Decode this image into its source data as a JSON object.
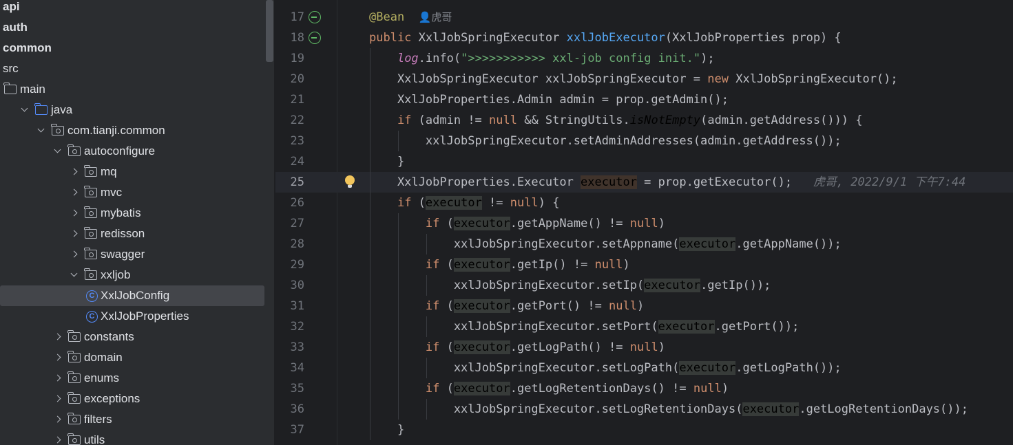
{
  "tree": [
    {
      "label": "api",
      "bold": true,
      "indent": 0,
      "arrow": "none",
      "icon": "none"
    },
    {
      "label": "auth",
      "bold": true,
      "indent": 0,
      "arrow": "none",
      "icon": "none"
    },
    {
      "label": "common",
      "bold": true,
      "indent": 0,
      "arrow": "none",
      "icon": "none"
    },
    {
      "label": "src",
      "bold": false,
      "indent": 0,
      "arrow": "none",
      "icon": "none"
    },
    {
      "label": "main",
      "bold": false,
      "indent": 0,
      "arrow": "none",
      "icon": "folder"
    },
    {
      "label": "java",
      "bold": false,
      "indent": 1,
      "arrow": "open",
      "icon": "folder-blue"
    },
    {
      "label": "com.tianji.common",
      "bold": false,
      "indent": 2,
      "arrow": "open",
      "icon": "package"
    },
    {
      "label": "autoconfigure",
      "bold": false,
      "indent": 3,
      "arrow": "open",
      "icon": "package"
    },
    {
      "label": "mq",
      "bold": false,
      "indent": 4,
      "arrow": "closed",
      "icon": "package"
    },
    {
      "label": "mvc",
      "bold": false,
      "indent": 4,
      "arrow": "closed",
      "icon": "package"
    },
    {
      "label": "mybatis",
      "bold": false,
      "indent": 4,
      "arrow": "closed",
      "icon": "package"
    },
    {
      "label": "redisson",
      "bold": false,
      "indent": 4,
      "arrow": "closed",
      "icon": "package"
    },
    {
      "label": "swagger",
      "bold": false,
      "indent": 4,
      "arrow": "closed",
      "icon": "package"
    },
    {
      "label": "xxljob",
      "bold": false,
      "indent": 4,
      "arrow": "open",
      "icon": "package"
    },
    {
      "label": "XxlJobConfig",
      "bold": false,
      "indent": 5,
      "arrow": "none",
      "icon": "class",
      "selected": true
    },
    {
      "label": "XxlJobProperties",
      "bold": false,
      "indent": 5,
      "arrow": "none",
      "icon": "class"
    },
    {
      "label": "constants",
      "bold": false,
      "indent": 3,
      "arrow": "closed",
      "icon": "package"
    },
    {
      "label": "domain",
      "bold": false,
      "indent": 3,
      "arrow": "closed",
      "icon": "package"
    },
    {
      "label": "enums",
      "bold": false,
      "indent": 3,
      "arrow": "closed",
      "icon": "package"
    },
    {
      "label": "exceptions",
      "bold": false,
      "indent": 3,
      "arrow": "closed",
      "icon": "package"
    },
    {
      "label": "filters",
      "bold": false,
      "indent": 3,
      "arrow": "closed",
      "icon": "package"
    },
    {
      "label": "utils",
      "bold": false,
      "indent": 3,
      "arrow": "closed",
      "icon": "package"
    }
  ],
  "editor": {
    "current_line": 25,
    "lines": [
      {
        "num": "17",
        "gutter": "bean-icon",
        "guides": 0,
        "segs": [
          [
            "ann",
            "@Bean"
          ],
          [
            "txt",
            "  "
          ],
          [
            "author",
            "👤虎哥"
          ]
        ]
      },
      {
        "num": "18",
        "gutter": "bean-icon",
        "guides": 0,
        "segs": [
          [
            "kw",
            "public "
          ],
          [
            "txt",
            "XxlJobSpringExecutor "
          ],
          [
            "fn",
            "xxlJobExecutor"
          ],
          [
            "txt",
            "(XxlJobProperties prop) {"
          ]
        ]
      },
      {
        "num": "19",
        "guides": 1,
        "segs": [
          [
            "txt",
            "    "
          ],
          [
            "fld",
            "log"
          ],
          [
            "txt",
            ".info("
          ],
          [
            "str",
            "\">>>>>>>>>>> xxl-job config init.\""
          ],
          [
            "txt",
            ");"
          ]
        ]
      },
      {
        "num": "20",
        "guides": 1,
        "segs": [
          [
            "txt",
            "    XxlJobSpringExecutor xxlJobSpringExecutor = "
          ],
          [
            "kw",
            "new "
          ],
          [
            "txt",
            "XxlJobSpringExecutor();"
          ]
        ]
      },
      {
        "num": "21",
        "guides": 1,
        "segs": [
          [
            "txt",
            "    XxlJobProperties.Admin admin = prop.getAdmin();"
          ]
        ]
      },
      {
        "num": "22",
        "guides": 1,
        "segs": [
          [
            "txt",
            "    "
          ],
          [
            "kw",
            "if "
          ],
          [
            "txt",
            "(admin != "
          ],
          [
            "kw",
            "null "
          ],
          [
            "txt",
            "&& StringUtils."
          ],
          [
            "ital",
            "isNotEmpty"
          ],
          [
            "txt",
            "(admin.getAddress())) {"
          ]
        ]
      },
      {
        "num": "23",
        "guides": 2,
        "segs": [
          [
            "txt",
            "        xxlJobSpringExecutor.setAdminAddresses(admin.getAddress());"
          ]
        ]
      },
      {
        "num": "24",
        "guides": 1,
        "segs": [
          [
            "txt",
            "    }"
          ]
        ]
      },
      {
        "num": "25",
        "gutter": "bulb",
        "guides": 1,
        "segs": [
          [
            "txt",
            "    XxlJobProperties.Executor "
          ],
          [
            "hlw",
            "executor"
          ],
          [
            "txt",
            " = prop.getExecutor();   "
          ],
          [
            "blame",
            "虎哥, 2022/9/1 下午7:44"
          ]
        ]
      },
      {
        "num": "26",
        "guides": 1,
        "segs": [
          [
            "txt",
            "    "
          ],
          [
            "kw",
            "if "
          ],
          [
            "txt",
            "("
          ],
          [
            "hl",
            "executor"
          ],
          [
            "txt",
            " != "
          ],
          [
            "kw",
            "null"
          ],
          [
            "txt",
            ") {"
          ]
        ]
      },
      {
        "num": "27",
        "guides": 2,
        "segs": [
          [
            "txt",
            "        "
          ],
          [
            "kw",
            "if "
          ],
          [
            "txt",
            "("
          ],
          [
            "hl",
            "executor"
          ],
          [
            "txt",
            ".getAppName() != "
          ],
          [
            "kw",
            "null"
          ],
          [
            "txt",
            ")"
          ]
        ]
      },
      {
        "num": "28",
        "guides": 3,
        "segs": [
          [
            "txt",
            "            xxlJobSpringExecutor.setAppname("
          ],
          [
            "hl",
            "executor"
          ],
          [
            "txt",
            ".getAppName());"
          ]
        ]
      },
      {
        "num": "29",
        "guides": 2,
        "segs": [
          [
            "txt",
            "        "
          ],
          [
            "kw",
            "if "
          ],
          [
            "txt",
            "("
          ],
          [
            "hl",
            "executor"
          ],
          [
            "txt",
            ".getIp() != "
          ],
          [
            "kw",
            "null"
          ],
          [
            "txt",
            ")"
          ]
        ]
      },
      {
        "num": "30",
        "guides": 3,
        "segs": [
          [
            "txt",
            "            xxlJobSpringExecutor.setIp("
          ],
          [
            "hl",
            "executor"
          ],
          [
            "txt",
            ".getIp());"
          ]
        ]
      },
      {
        "num": "31",
        "guides": 2,
        "segs": [
          [
            "txt",
            "        "
          ],
          [
            "kw",
            "if "
          ],
          [
            "txt",
            "("
          ],
          [
            "hl",
            "executor"
          ],
          [
            "txt",
            ".getPort() != "
          ],
          [
            "kw",
            "null"
          ],
          [
            "txt",
            ")"
          ]
        ]
      },
      {
        "num": "32",
        "guides": 3,
        "segs": [
          [
            "txt",
            "            xxlJobSpringExecutor.setPort("
          ],
          [
            "hl",
            "executor"
          ],
          [
            "txt",
            ".getPort());"
          ]
        ]
      },
      {
        "num": "33",
        "guides": 2,
        "segs": [
          [
            "txt",
            "        "
          ],
          [
            "kw",
            "if "
          ],
          [
            "txt",
            "("
          ],
          [
            "hl",
            "executor"
          ],
          [
            "txt",
            ".getLogPath() != "
          ],
          [
            "kw",
            "null"
          ],
          [
            "txt",
            ")"
          ]
        ]
      },
      {
        "num": "34",
        "guides": 3,
        "segs": [
          [
            "txt",
            "            xxlJobSpringExecutor.setLogPath("
          ],
          [
            "hl",
            "executor"
          ],
          [
            "txt",
            ".getLogPath());"
          ]
        ]
      },
      {
        "num": "35",
        "guides": 2,
        "segs": [
          [
            "txt",
            "        "
          ],
          [
            "kw",
            "if "
          ],
          [
            "txt",
            "("
          ],
          [
            "hl",
            "executor"
          ],
          [
            "txt",
            ".getLogRetentionDays() != "
          ],
          [
            "kw",
            "null"
          ],
          [
            "txt",
            ")"
          ]
        ]
      },
      {
        "num": "36",
        "guides": 3,
        "segs": [
          [
            "txt",
            "            xxlJobSpringExecutor.setLogRetentionDays("
          ],
          [
            "hl",
            "executor"
          ],
          [
            "txt",
            ".getLogRetentionDays());"
          ]
        ]
      },
      {
        "num": "37",
        "guides": 1,
        "segs": [
          [
            "txt",
            "    }"
          ]
        ]
      }
    ]
  },
  "colors": {
    "editor_bg": "#1e1f22",
    "sidebar_bg": "#2b2d30",
    "keyword": "#cf8e6d",
    "annotation": "#b3ae60",
    "method": "#56a8f5",
    "string": "#6aab73",
    "static_field": "#c77dbb",
    "text": "#bcbec4"
  }
}
